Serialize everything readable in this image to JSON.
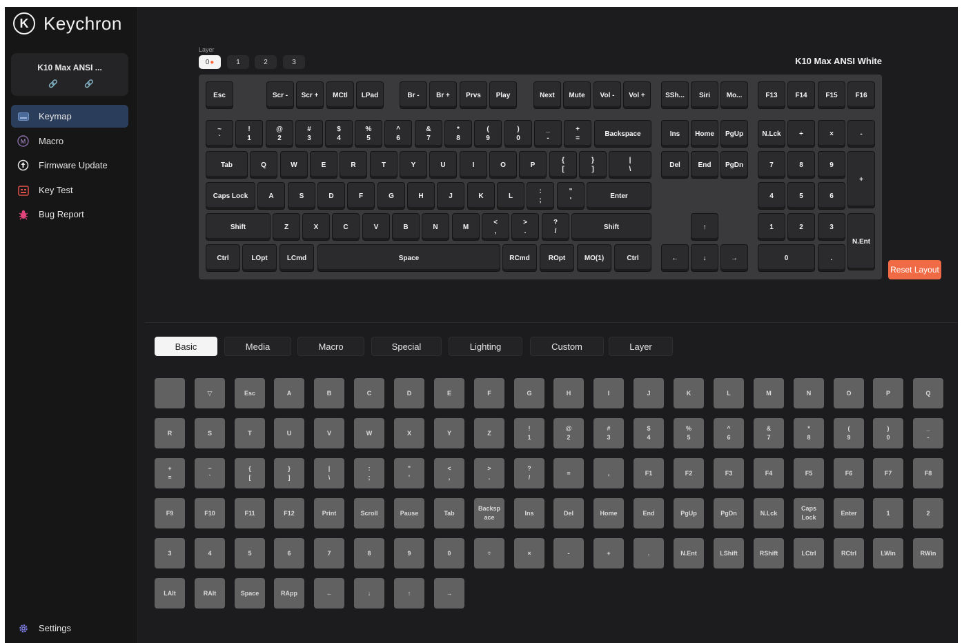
{
  "sidebar": {
    "brand": "Keychron",
    "device_name": "K10 Max ANSI ...",
    "items": [
      {
        "label": "Keymap",
        "icon": "keyboard-icon",
        "active": true
      },
      {
        "label": "Macro",
        "icon": "macro-icon"
      },
      {
        "label": "Firmware Update",
        "icon": "firmware-icon"
      },
      {
        "label": "Key Test",
        "icon": "key-test-icon"
      },
      {
        "label": "Bug Report",
        "icon": "bug-icon"
      }
    ],
    "settings_label": "Settings"
  },
  "layer": {
    "label": "Layer",
    "buttons": [
      "0",
      "1",
      "2",
      "3"
    ],
    "active": "0"
  },
  "keyboard_title": "K10 Max ANSI White",
  "reset_label": "Reset Layout",
  "keys": [
    [
      "Esc"
    ],
    [
      "Scr -"
    ],
    [
      "Scr +"
    ],
    [
      "MCtl"
    ],
    [
      "LPad"
    ],
    [
      "Br -"
    ],
    [
      "Br +"
    ],
    [
      "Prvs"
    ],
    [
      "Play"
    ],
    [
      "Next"
    ],
    [
      "Mute"
    ],
    [
      "Vol -"
    ],
    [
      "Vol +"
    ],
    [
      "SSh..."
    ],
    [
      "Siri"
    ],
    [
      "Mo..."
    ],
    [
      "F13"
    ],
    [
      "F14"
    ],
    [
      "F15"
    ],
    [
      "F16"
    ],
    [
      "~",
      "`"
    ],
    [
      "!",
      "1"
    ],
    [
      "@",
      "2"
    ],
    [
      "#",
      "3"
    ],
    [
      "$",
      "4"
    ],
    [
      "%",
      "5"
    ],
    [
      "^",
      "6"
    ],
    [
      "&",
      "7"
    ],
    [
      "*",
      "8"
    ],
    [
      "(",
      "9"
    ],
    [
      ")",
      "0"
    ],
    [
      "_",
      "-"
    ],
    [
      "+",
      "="
    ],
    [
      "Backspace"
    ],
    [
      "Ins"
    ],
    [
      "Home"
    ],
    [
      "PgUp"
    ],
    [
      "N.Lck"
    ],
    [
      "÷"
    ],
    [
      "×"
    ],
    [
      "-"
    ],
    [
      "Tab"
    ],
    [
      "Q"
    ],
    [
      "W"
    ],
    [
      "E"
    ],
    [
      "R"
    ],
    [
      "T"
    ],
    [
      "Y"
    ],
    [
      "U"
    ],
    [
      "I"
    ],
    [
      "O"
    ],
    [
      "P"
    ],
    [
      "{",
      "["
    ],
    [
      "}",
      "]"
    ],
    [
      "|",
      "\\"
    ],
    [
      "Del"
    ],
    [
      "End"
    ],
    [
      "PgDn"
    ],
    [
      "7"
    ],
    [
      "8"
    ],
    [
      "9"
    ],
    [
      "+"
    ],
    [
      "Caps Lock"
    ],
    [
      "A"
    ],
    [
      "S"
    ],
    [
      "D"
    ],
    [
      "F"
    ],
    [
      "G"
    ],
    [
      "H"
    ],
    [
      "J"
    ],
    [
      "K"
    ],
    [
      "L"
    ],
    [
      ":",
      ";"
    ],
    [
      "\"",
      "'"
    ],
    [
      "Enter"
    ],
    [
      "4"
    ],
    [
      "5"
    ],
    [
      "6"
    ],
    [
      "Shift"
    ],
    [
      "Z"
    ],
    [
      "X"
    ],
    [
      "C"
    ],
    [
      "V"
    ],
    [
      "B"
    ],
    [
      "N"
    ],
    [
      "M"
    ],
    [
      "<",
      ","
    ],
    [
      ">",
      "."
    ],
    [
      "?",
      "/"
    ],
    [
      "Shift"
    ],
    [
      "↑"
    ],
    [
      "1"
    ],
    [
      "2"
    ],
    [
      "3"
    ],
    [
      "N.Ent"
    ],
    [
      "Ctrl"
    ],
    [
      "LOpt"
    ],
    [
      "LCmd"
    ],
    [
      "Space"
    ],
    [
      "RCmd"
    ],
    [
      "ROpt"
    ],
    [
      "MO(1)"
    ],
    [
      "Ctrl"
    ],
    [
      "←"
    ],
    [
      "↓"
    ],
    [
      "→"
    ],
    [
      "0"
    ],
    [
      "."
    ]
  ],
  "tabs": [
    "Basic",
    "Media",
    "Macro",
    "Special",
    "Lighting",
    "Custom",
    "Layer"
  ],
  "active_tab": "Basic",
  "palette": [
    [
      ""
    ],
    [
      "▽"
    ],
    [
      "Esc"
    ],
    [
      "A"
    ],
    [
      "B"
    ],
    [
      "C"
    ],
    [
      "D"
    ],
    [
      "E"
    ],
    [
      "F"
    ],
    [
      "G"
    ],
    [
      "H"
    ],
    [
      "I"
    ],
    [
      "J"
    ],
    [
      "K"
    ],
    [
      "L"
    ],
    [
      "M"
    ],
    [
      "N"
    ],
    [
      "O"
    ],
    [
      "P"
    ],
    [
      "Q"
    ],
    [
      "R"
    ],
    [
      "S"
    ],
    [
      "T"
    ],
    [
      "U"
    ],
    [
      "V"
    ],
    [
      "W"
    ],
    [
      "X"
    ],
    [
      "Y"
    ],
    [
      "Z"
    ],
    [
      "!",
      "1"
    ],
    [
      "@",
      "2"
    ],
    [
      "#",
      "3"
    ],
    [
      "$",
      "4"
    ],
    [
      "%",
      "5"
    ],
    [
      "^",
      "6"
    ],
    [
      "&",
      "7"
    ],
    [
      "*",
      "8"
    ],
    [
      "(",
      "9"
    ],
    [
      ")",
      "0"
    ],
    [
      "_",
      "-"
    ],
    [
      "+",
      "="
    ],
    [
      "~",
      "`"
    ],
    [
      "{",
      "["
    ],
    [
      "}",
      "]"
    ],
    [
      "|",
      "\\"
    ],
    [
      ":",
      ";"
    ],
    [
      "\"",
      "'"
    ],
    [
      "<",
      ","
    ],
    [
      ">",
      "."
    ],
    [
      "?",
      "/"
    ],
    [
      "="
    ],
    [
      ","
    ],
    [
      "F1"
    ],
    [
      "F2"
    ],
    [
      "F3"
    ],
    [
      "F4"
    ],
    [
      "F5"
    ],
    [
      "F6"
    ],
    [
      "F7"
    ],
    [
      "F8"
    ],
    [
      "F9"
    ],
    [
      "F10"
    ],
    [
      "F11"
    ],
    [
      "F12"
    ],
    [
      "Print"
    ],
    [
      "Scroll"
    ],
    [
      "Pause"
    ],
    [
      "Tab"
    ],
    [
      "Backsp",
      "ace"
    ],
    [
      "Ins"
    ],
    [
      "Del"
    ],
    [
      "Home"
    ],
    [
      "End"
    ],
    [
      "PgUp"
    ],
    [
      "PgDn"
    ],
    [
      "N.Lck"
    ],
    [
      "Caps",
      "Lock"
    ],
    [
      "Enter"
    ],
    [
      "1"
    ],
    [
      "2"
    ],
    [
      "3"
    ],
    [
      "4"
    ],
    [
      "5"
    ],
    [
      "6"
    ],
    [
      "7"
    ],
    [
      "8"
    ],
    [
      "9"
    ],
    [
      "0"
    ],
    [
      "÷"
    ],
    [
      "×"
    ],
    [
      "-"
    ],
    [
      "+"
    ],
    [
      "."
    ],
    [
      "N.Ent"
    ],
    [
      "LShift"
    ],
    [
      "RShift"
    ],
    [
      "LCtrl"
    ],
    [
      "RCtrl"
    ],
    [
      "LWin"
    ],
    [
      "RWin"
    ],
    [
      "LAlt"
    ],
    [
      "RAlt"
    ],
    [
      "Space"
    ],
    [
      "RApp"
    ],
    [
      "←"
    ],
    [
      "↓"
    ],
    [
      "↑"
    ],
    [
      "→"
    ]
  ],
  "colors": {
    "accent_active_nav": "#2a3e5c",
    "reset_button": "#f06b45",
    "layer_dot": "#ff6a3d"
  }
}
